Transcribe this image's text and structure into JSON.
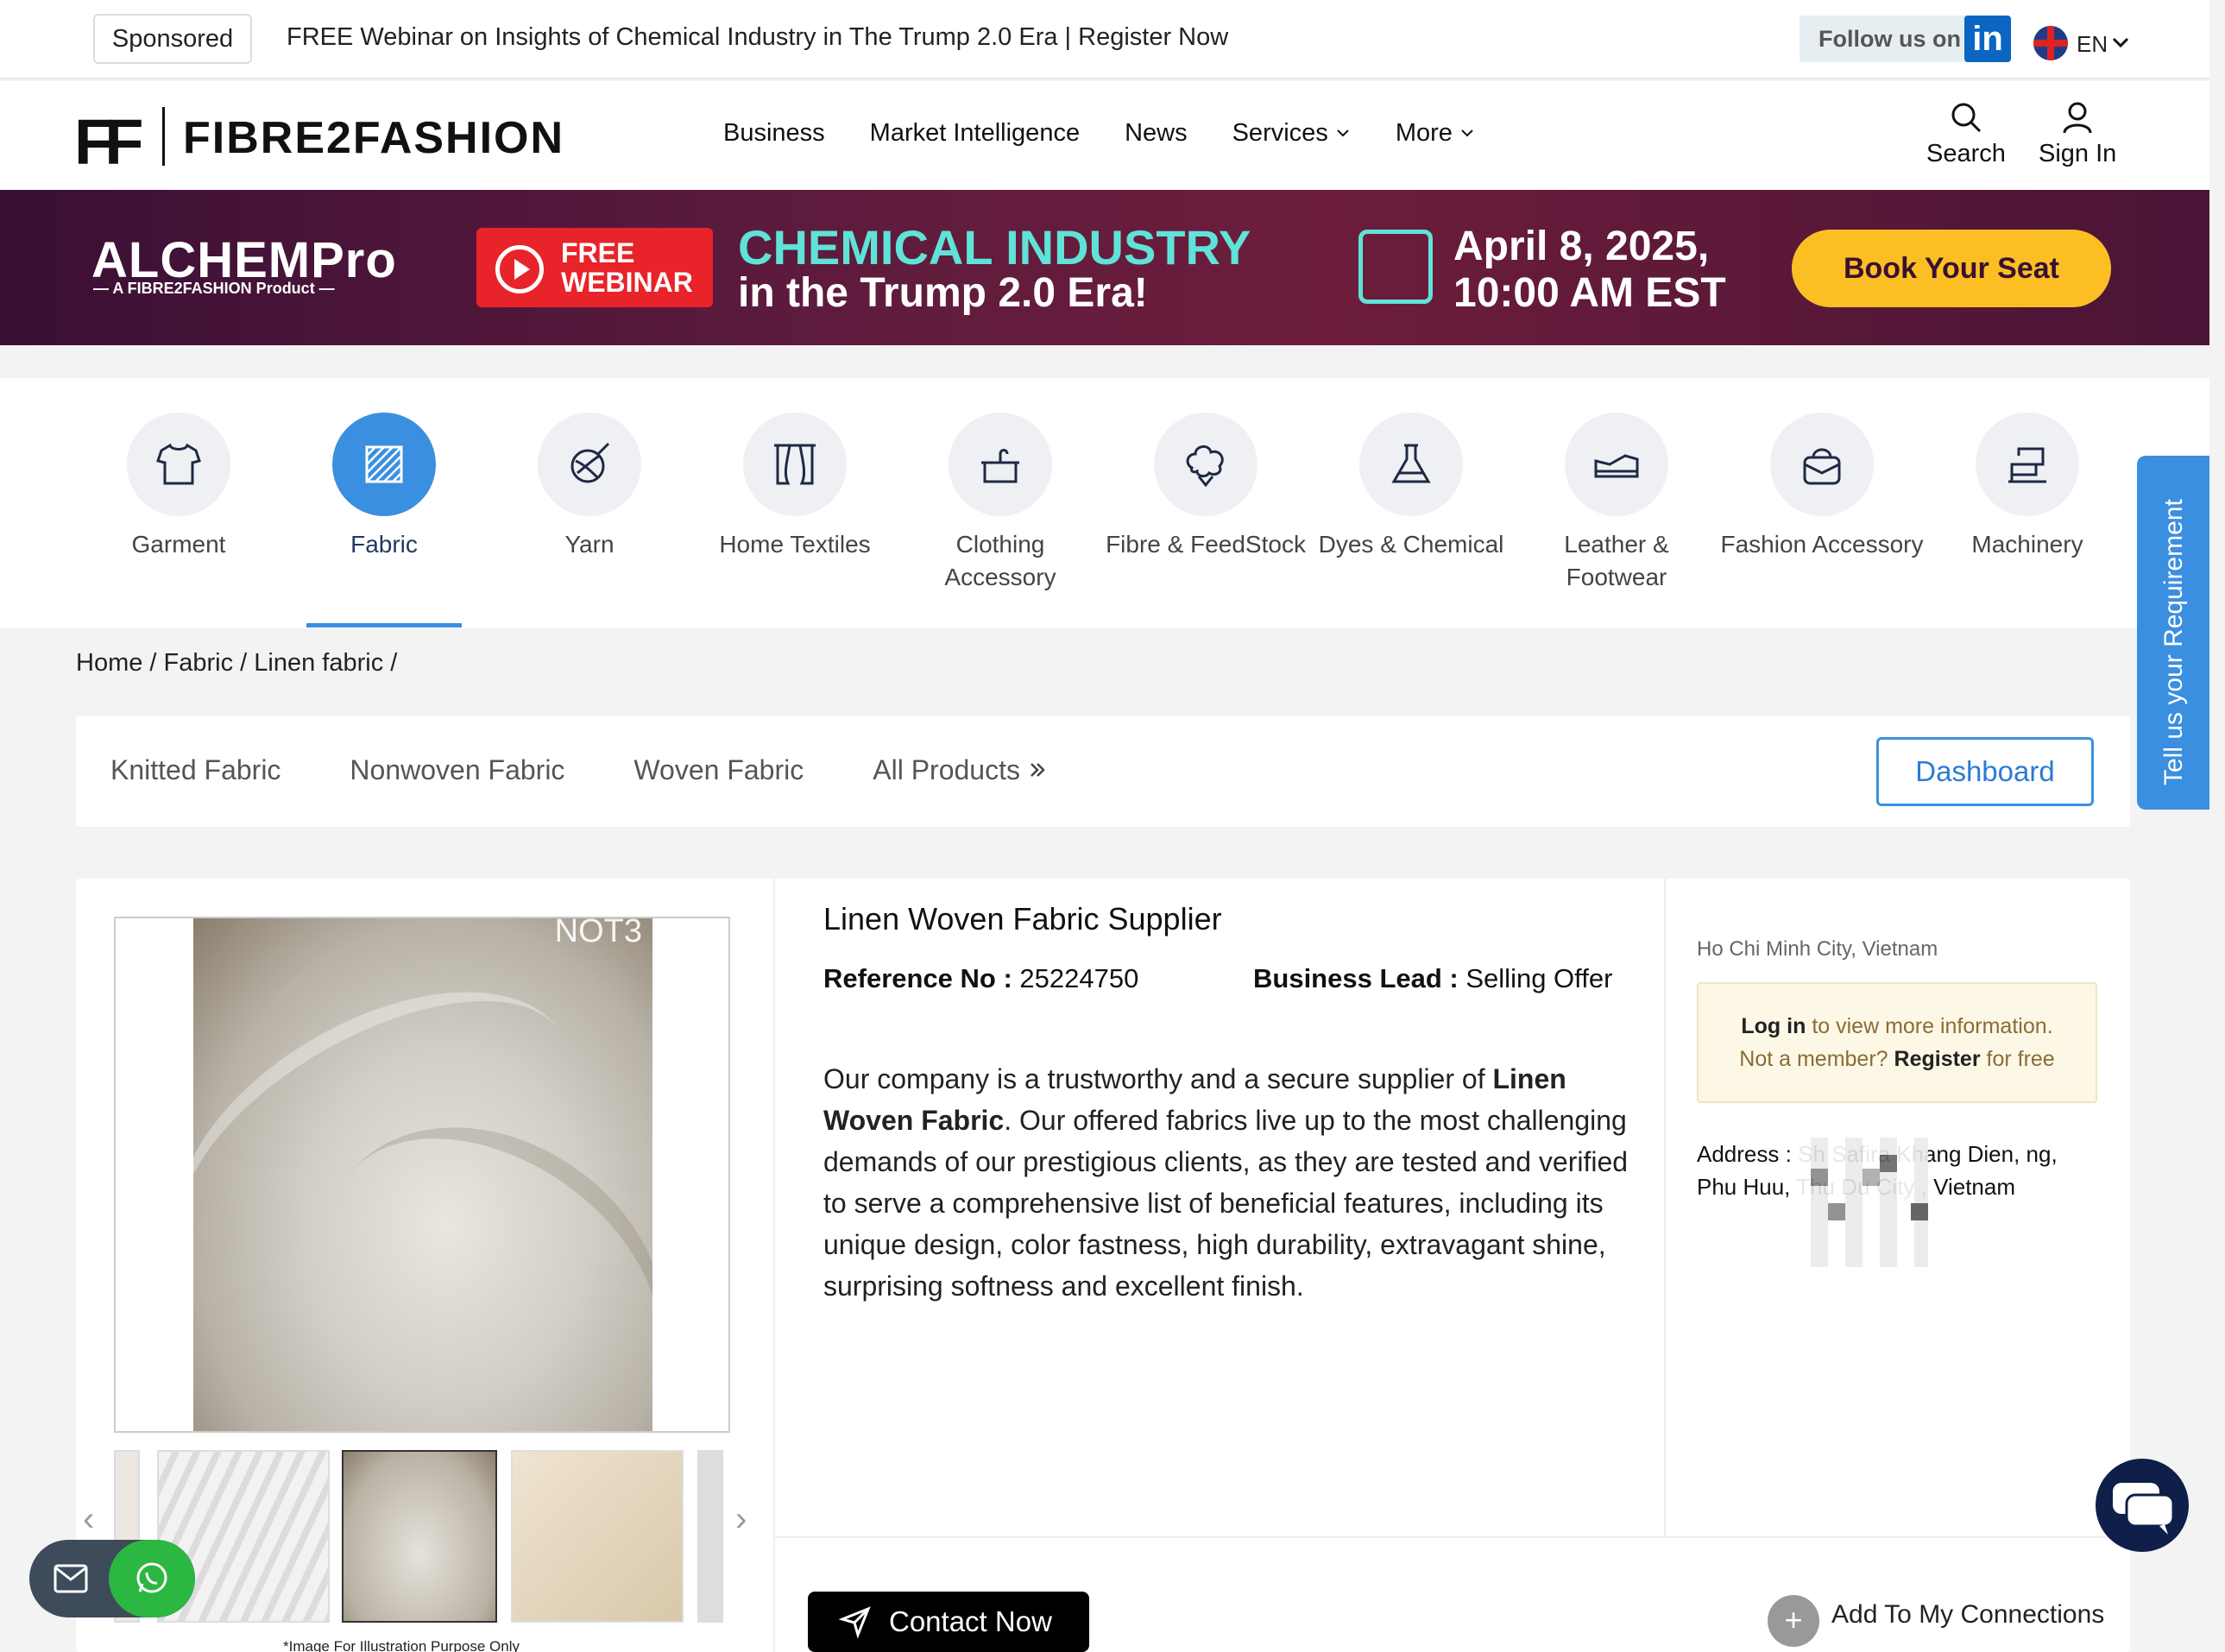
{
  "topbar": {
    "sponsored": "Sponsored",
    "promo": "FREE Webinar on Insights of Chemical Industry in The Trump 2.0 Era | Register Now",
    "follow": "Follow us on",
    "linkedin_icon": "in",
    "language": "EN"
  },
  "header": {
    "logo_mark": "FF",
    "logo_text": "FIBRE2FASHION",
    "nav": [
      "Business",
      "Market Intelligence",
      "News",
      "Services",
      "More"
    ],
    "search": "Search",
    "signin": "Sign In"
  },
  "banner": {
    "brand": "ALCHEMPro",
    "brand_sub": "— A FIBRE2FASHION Product —",
    "free": "FREE",
    "webinar": "WEBINAR",
    "headline1": "CHEMICAL INDUSTRY",
    "headline2": "in the Trump 2.0 Era!",
    "date1": "April 8, 2025,",
    "date2": "10:00 AM EST",
    "cta": "Book Your Seat"
  },
  "categories": [
    {
      "label": "Garment",
      "icon": "shirt-icon"
    },
    {
      "label": "Fabric",
      "icon": "fabric-icon",
      "active": true
    },
    {
      "label": "Yarn",
      "icon": "yarn-icon"
    },
    {
      "label": "Home Textiles",
      "icon": "curtain-icon"
    },
    {
      "label": "Clothing Accessory",
      "icon": "hanger-icon"
    },
    {
      "label": "Fibre & FeedStock",
      "icon": "cotton-icon"
    },
    {
      "label": "Dyes & Chemical",
      "icon": "flask-icon"
    },
    {
      "label": "Leather & Footwear",
      "icon": "shoe-icon"
    },
    {
      "label": "Fashion Accessory",
      "icon": "bag-icon"
    },
    {
      "label": "Machinery",
      "icon": "machine-icon"
    }
  ],
  "breadcrumb": "Home / Fabric / Linen fabric /",
  "subnav": {
    "items": [
      "Knitted Fabric",
      "Nonwoven Fabric",
      "Woven Fabric",
      "All Products"
    ],
    "dashboard": "Dashboard"
  },
  "side_tab": "Tell us your Requirement",
  "product": {
    "title": "Linen Woven Fabric Supplier",
    "ref_label": "Reference No :",
    "ref_value": "25224750",
    "lead_label": "Business Lead :",
    "lead_value": "Selling Offer",
    "desc_pre": "Our company is a trustworthy and a secure supplier of ",
    "desc_bold": "Linen Woven Fabric",
    "desc_post": ". Our offered fabrics live up to the most challenging demands of our prestigious clients, as they are tested and verified to serve a comprehensive list of beneficial features, including its unique design, color fastness, high durability, extravagant shine, surprising softness and excellent finish.",
    "image_mark": "NOT3",
    "image_note": "*Image For Illustration Purpose Only"
  },
  "seller": {
    "location": "Ho Chi Minh City, Vietnam",
    "login": "Log in",
    "login_rest": " to view more information.",
    "not_member": "Not a member? ",
    "register": "Register",
    "register_rest": " for free",
    "address": "Address : Sh          Safira Khang Dien,          ng, Phu Huu, Thu Du          City , Vietnam"
  },
  "actions": {
    "contact": "Contact Now",
    "add": "Add To My Connections"
  },
  "colors": {
    "accent": "#3b8fe0",
    "cta": "#fbbf24",
    "banner": "#5c1b3d"
  }
}
